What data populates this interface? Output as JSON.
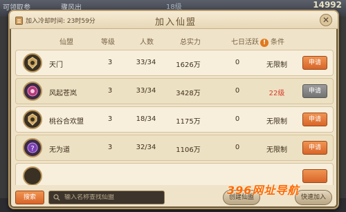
{
  "background": {
    "left_text": "可领取参",
    "mid_text": "骤风出",
    "floor_text": "18级",
    "gold": "14992"
  },
  "panel": {
    "cooldown_label": "加入冷却时间: 23时59分",
    "title": "加入仙盟",
    "close": "✕"
  },
  "columns": {
    "name": "仙盟",
    "level": "等级",
    "members": "人数",
    "power": "总实力",
    "activity": "七日活跃",
    "condition": "条件"
  },
  "alliances": [
    {
      "name": "天门",
      "level": "3",
      "members": "33/34",
      "power": "1626万",
      "activity": "0",
      "condition": "无限制",
      "button": "申请",
      "enabled": true,
      "emblem": "gold-crest-icon"
    },
    {
      "name": "风起苍岚",
      "level": "3",
      "members": "33/34",
      "power": "3428万",
      "activity": "0",
      "condition": "22级",
      "button": "申请",
      "enabled": false,
      "emblem": "pink-lotus-icon"
    },
    {
      "name": "桃谷合欢盟",
      "level": "3",
      "members": "18/34",
      "power": "1175万",
      "activity": "0",
      "condition": "无限制",
      "button": "申请",
      "enabled": true,
      "emblem": "gold-crest-icon"
    },
    {
      "name": "无为道",
      "level": "3",
      "members": "32/34",
      "power": "1106万",
      "activity": "0",
      "condition": "无限制",
      "button": "申请",
      "enabled": true,
      "emblem": "purple-orb-icon"
    }
  ],
  "bottom": {
    "search_button": "搜索",
    "search_placeholder": "输入名称查找仙盟",
    "create_button": "创建仙盟",
    "quick_button": "快速加入"
  },
  "watermark": "396网址导航",
  "colors": {
    "accent_orange": "#d8652a",
    "panel_bg": "#efe3c9",
    "condition_red": "#d43a2a"
  }
}
